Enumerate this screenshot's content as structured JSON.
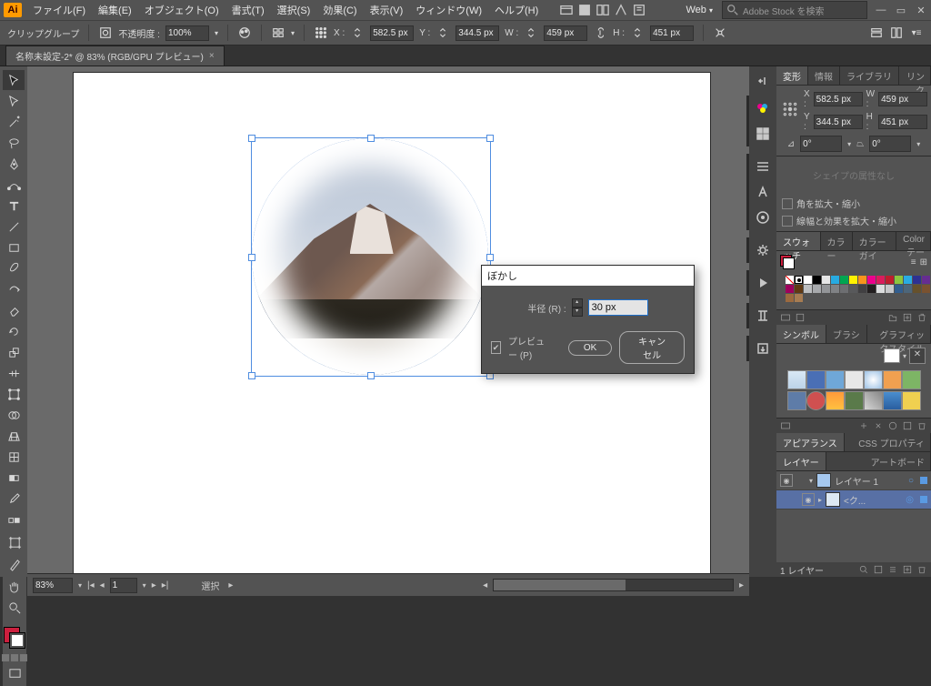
{
  "menu": {
    "file": "ファイル(F)",
    "edit": "編集(E)",
    "object": "オブジェクト(O)",
    "type": "書式(T)",
    "select": "選択(S)",
    "effect": "効果(C)",
    "view": "表示(V)",
    "window": "ウィンドウ(W)",
    "help": "ヘルプ(H)"
  },
  "workspace": "Web",
  "search_placeholder": "Adobe Stock を検索",
  "optbar": {
    "label": "クリップグループ",
    "opacity_label": "不透明度 :",
    "opacity": "100%",
    "x_label": "X :",
    "x": "582.5 px",
    "y_label": "Y :",
    "y": "344.5 px",
    "w_label": "W :",
    "w": "459 px",
    "h_label": "H :",
    "h": "451 px"
  },
  "doc_title": "名称未設定-2* @ 83% (RGB/GPU プレビュー)",
  "dialog": {
    "title": "ぼかし",
    "radius_label": "半径 (R) :",
    "radius": "30 px",
    "preview": "プレビュー (P)",
    "ok": "OK",
    "cancel": "キャンセル"
  },
  "transform_tabs": [
    "変形",
    "情報",
    "ライブラリ",
    "リンク"
  ],
  "xform": {
    "x_label": "X :",
    "x": "582.5 px",
    "y_label": "Y :",
    "y": "344.5 px",
    "w_label": "W :",
    "w": "459 px",
    "h_label": "H :",
    "h": "451 px",
    "angle": "0°",
    "shear": "0°"
  },
  "shape_msg": "シェイプの属性なし",
  "chk1": "角を拡大・縮小",
  "chk2": "線幅と効果を拡大・縮小",
  "swatch_tabs": [
    "スウォッチ",
    "カラー",
    "カラーガイ",
    "Color テー"
  ],
  "symbol_tabs": [
    "シンボル",
    "ブラシ",
    "グラフィックスタイル"
  ],
  "appearance_tabs": [
    "アピアランス",
    "CSS プロパティ"
  ],
  "layer_tabs": [
    "レイヤー",
    "アートボード"
  ],
  "layer1": "レイヤー 1",
  "layer1_sub": "<ク...",
  "zoom": "83%",
  "status_label": "選択",
  "layer_count": "1 レイヤー",
  "swatch_colors": [
    "#ffffff",
    "#000000",
    "#e6e6e6",
    "#27aae1",
    "#00a651",
    "#fff200",
    "#f7941d",
    "#ec008c",
    "#da1c5c",
    "#be1e2d",
    "#8cc63f",
    "#29abe2",
    "#2e3192",
    "#662d91",
    "#ed145b",
    "#9e005d",
    "#603913",
    "#bcbec0",
    "#a7a9ac",
    "#939598",
    "#808285",
    "#6d6e71",
    "#58595b",
    "#414042",
    "#231f20",
    "#dcddde",
    "#c7c8ca",
    "#335e8e",
    "#4d667a",
    "#66512c",
    "#7a5230",
    "#8b572a",
    "#9b6a3f",
    "#a67c52"
  ]
}
